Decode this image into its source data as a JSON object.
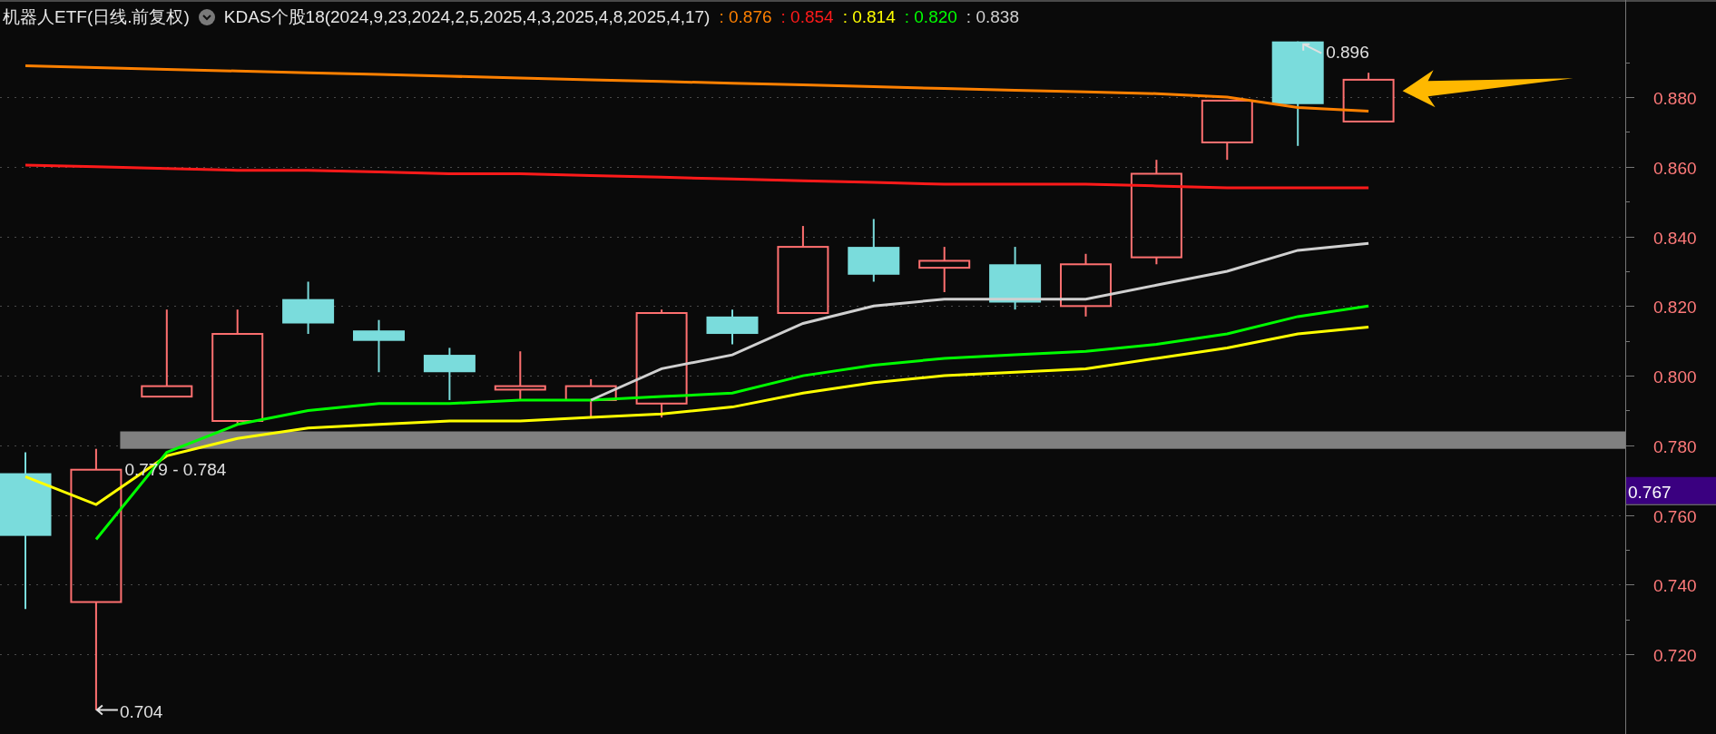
{
  "header": {
    "title": "机器人ETF(日线.前复权)",
    "indicator": "KDAS个股18(2024,9,23,2024,2,5,2025,4,3,2025,4,8,2025,4,17)",
    "legend": [
      {
        "text": ": 0.876",
        "color": "#ff8000"
      },
      {
        "text": ": 0.854",
        "color": "#ff1a1a"
      },
      {
        "text": ": 0.814",
        "color": "#ffff00"
      },
      {
        "text": ": 0.820",
        "color": "#00ff00"
      },
      {
        "text": ": 0.838",
        "color": "#d0d0d0"
      }
    ]
  },
  "price_tag": {
    "label": "0.767"
  },
  "chart_data": {
    "type": "line",
    "ylim": [
      0.6971,
      0.9079
    ],
    "grid": true,
    "yticks": [
      {
        "value": 0.72,
        "label": "0.720"
      },
      {
        "value": 0.74,
        "label": "0.740"
      },
      {
        "value": 0.76,
        "label": "0.760"
      },
      {
        "value": 0.78,
        "label": "0.780"
      },
      {
        "value": 0.8,
        "label": "0.800"
      },
      {
        "value": 0.82,
        "label": "0.820"
      },
      {
        "value": 0.84,
        "label": "0.840"
      },
      {
        "value": 0.86,
        "label": "0.860"
      },
      {
        "value": 0.88,
        "label": "0.880"
      }
    ],
    "series": [
      {
        "color": "#ff8000",
        "values": [
          0.889,
          0.8885,
          0.888,
          0.8875,
          0.887,
          0.8865,
          0.886,
          0.8855,
          0.885,
          0.8845,
          0.884,
          0.8835,
          0.883,
          0.8825,
          0.882,
          0.8815,
          0.881,
          0.88,
          0.877,
          0.876
        ]
      },
      {
        "color": "#ff1a1a",
        "values": [
          0.8605,
          0.86,
          0.8595,
          0.859,
          0.859,
          0.8585,
          0.858,
          0.858,
          0.8575,
          0.857,
          0.8565,
          0.856,
          0.8555,
          0.855,
          0.855,
          0.855,
          0.8545,
          0.854,
          0.854,
          0.854
        ]
      },
      {
        "color": "#ffff00",
        "values": [
          0.771,
          0.763,
          0.777,
          0.782,
          0.785,
          0.786,
          0.787,
          0.787,
          0.788,
          0.789,
          0.791,
          0.795,
          0.798,
          0.8,
          0.801,
          0.802,
          0.805,
          0.808,
          0.812,
          0.814
        ]
      },
      {
        "color": "#00ff00",
        "values": [
          null,
          0.753,
          0.778,
          0.786,
          0.79,
          0.792,
          0.792,
          0.793,
          0.793,
          0.794,
          0.795,
          0.8,
          0.803,
          0.805,
          0.806,
          0.807,
          0.809,
          0.812,
          0.817,
          0.82
        ]
      },
      {
        "color": "#d0d0d0",
        "values": [
          null,
          null,
          null,
          null,
          null,
          null,
          null,
          null,
          0.793,
          0.802,
          0.806,
          0.815,
          0.82,
          0.822,
          0.822,
          0.822,
          0.826,
          0.83,
          0.836,
          0.838
        ]
      }
    ],
    "bands": [
      {
        "axis": "y",
        "from": 0.779,
        "to": 0.784,
        "color": "#808080",
        "label": "0.779 - 0.784"
      }
    ],
    "annotations": [
      {
        "text": "0.704"
      },
      {
        "text": "0.896"
      }
    ]
  }
}
